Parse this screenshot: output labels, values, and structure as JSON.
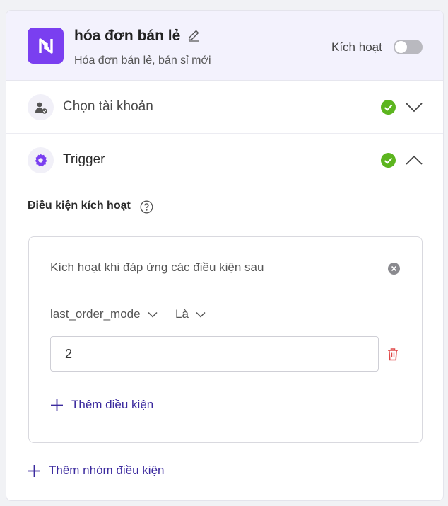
{
  "header": {
    "title": "hóa đơn bán lẻ",
    "subtitle": "Hóa đơn bán lẻ, bán sỉ mới",
    "activate_label": "Kích hoạt",
    "activate_on": false,
    "logo_icon": "brand-n-logo-icon",
    "edit_icon": "pencil-icon"
  },
  "sections": [
    {
      "label": "Chọn tài khoản",
      "icon": "user-check-icon",
      "status": "complete",
      "expanded": false
    },
    {
      "label": "Trigger",
      "icon": "gear-icon",
      "status": "complete",
      "expanded": true
    }
  ],
  "trigger": {
    "condition_label": "Điều kiện kích hoạt",
    "group": {
      "title": "Kích hoạt khi đáp ứng các điều kiện sau",
      "field": "last_order_mode",
      "operator": "Là",
      "value": "2",
      "add_condition_label": "Thêm điều kiện"
    },
    "add_group_label": "Thêm nhóm điều kiện"
  },
  "colors": {
    "accent": "#7a3ff0",
    "success": "#5cb51f",
    "link": "#3b2a9e",
    "danger": "#e04848",
    "header_bg": "#f3f2fd"
  }
}
